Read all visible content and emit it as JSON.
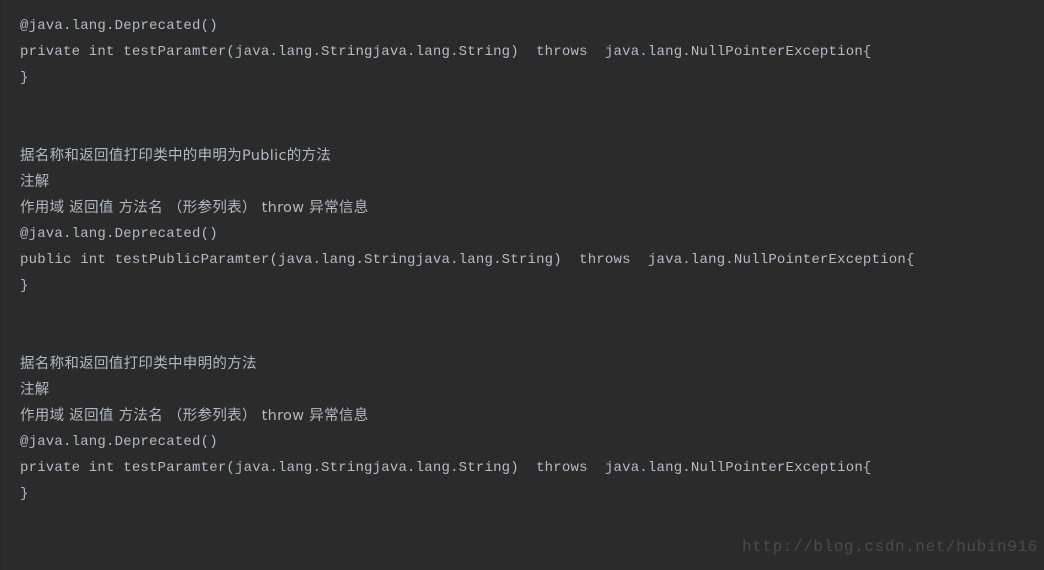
{
  "console": {
    "background_color": "#2b2b2b",
    "text_color": "#b6bfc9",
    "watermark_color": "#4b4b4b",
    "lines": [
      {
        "kind": "code",
        "text": "@java.lang.Deprecated()"
      },
      {
        "kind": "code",
        "text": "private int testParamter(java.lang.Stringjava.lang.String)  throws  java.lang.NullPointerException{"
      },
      {
        "kind": "code",
        "text": "}"
      },
      {
        "kind": "blank",
        "text": ""
      },
      {
        "kind": "blank",
        "text": ""
      },
      {
        "kind": "cjk",
        "text": "据名称和返回值打印类中的申明为Public的方法"
      },
      {
        "kind": "cjk",
        "text": "注解"
      },
      {
        "kind": "cjk",
        "text": "作用域 返回值 方法名 （形参列表） throw 异常信息"
      },
      {
        "kind": "code",
        "text": "@java.lang.Deprecated()"
      },
      {
        "kind": "code",
        "text": "public int testPublicParamter(java.lang.Stringjava.lang.String)  throws  java.lang.NullPointerException{"
      },
      {
        "kind": "code",
        "text": "}"
      },
      {
        "kind": "blank",
        "text": ""
      },
      {
        "kind": "blank",
        "text": ""
      },
      {
        "kind": "cjk",
        "text": "据名称和返回值打印类中申明的方法"
      },
      {
        "kind": "cjk",
        "text": "注解"
      },
      {
        "kind": "cjk",
        "text": "作用域 返回值 方法名 （形参列表） throw 异常信息"
      },
      {
        "kind": "code",
        "text": "@java.lang.Deprecated()"
      },
      {
        "kind": "code",
        "text": "private int testParamter(java.lang.Stringjava.lang.String)  throws  java.lang.NullPointerException{"
      },
      {
        "kind": "code",
        "text": "}"
      }
    ],
    "watermark": "http://blog.csdn.net/hubin916"
  }
}
